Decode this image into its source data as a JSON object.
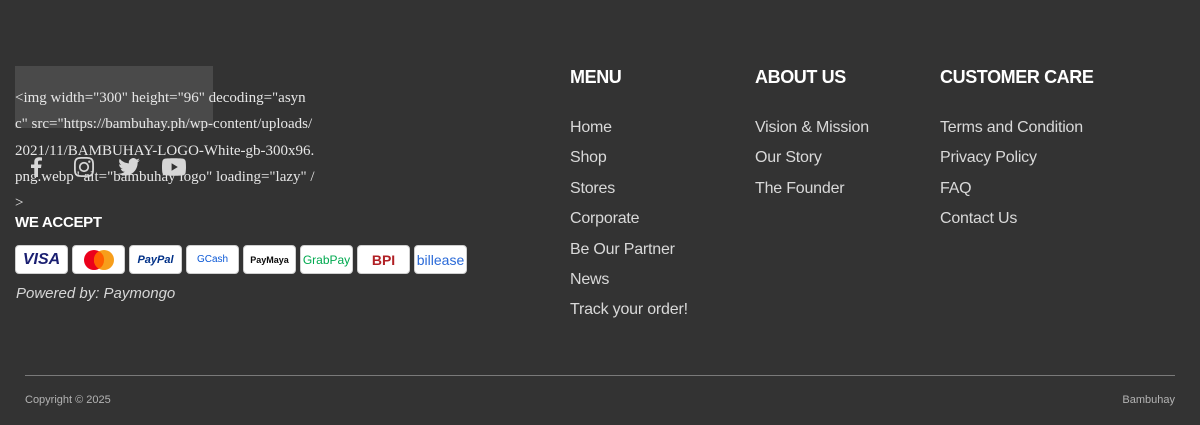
{
  "logo": {
    "broken_img_markup": "<img width=\"300\" height=\"96\" decoding=\"async\" src=\"https://bambuhay.ph/wp-content/uploads/2021/11/BAMBUHAY-LOGO-White-gb-300x96.png.webp\" alt=\"bambuhay logo\" loading=\"lazy\" />"
  },
  "socials": [
    {
      "name": "facebook-icon"
    },
    {
      "name": "instagram-icon"
    },
    {
      "name": "twitter-icon"
    },
    {
      "name": "youtube-icon"
    }
  ],
  "payments": {
    "heading": "WE ACCEPT",
    "methods": [
      "VISA",
      "Mastercard",
      "PayPal",
      "GCash",
      "PayMaya",
      "GrabPay",
      "BPI",
      "billease"
    ],
    "powered_by": "Powered by: Paymongo"
  },
  "menu": {
    "title": "MENU",
    "items": [
      "Home",
      "Shop",
      "Stores",
      "Corporate",
      "Be Our Partner",
      "News",
      "Track your order!"
    ]
  },
  "about": {
    "title": "ABOUT US",
    "items": [
      "Vision & Mission",
      "Our Story",
      "The Founder"
    ]
  },
  "care": {
    "title": "CUSTOMER CARE",
    "items": [
      "Terms and Condition",
      "Privacy Policy",
      "FAQ",
      "Contact Us"
    ]
  },
  "footer": {
    "copyright": "Copyright © 2025",
    "brand": "Bambuhay"
  },
  "colors": {
    "background": "#333333",
    "text": "#ffffff",
    "muted": "#b3b3b3"
  }
}
